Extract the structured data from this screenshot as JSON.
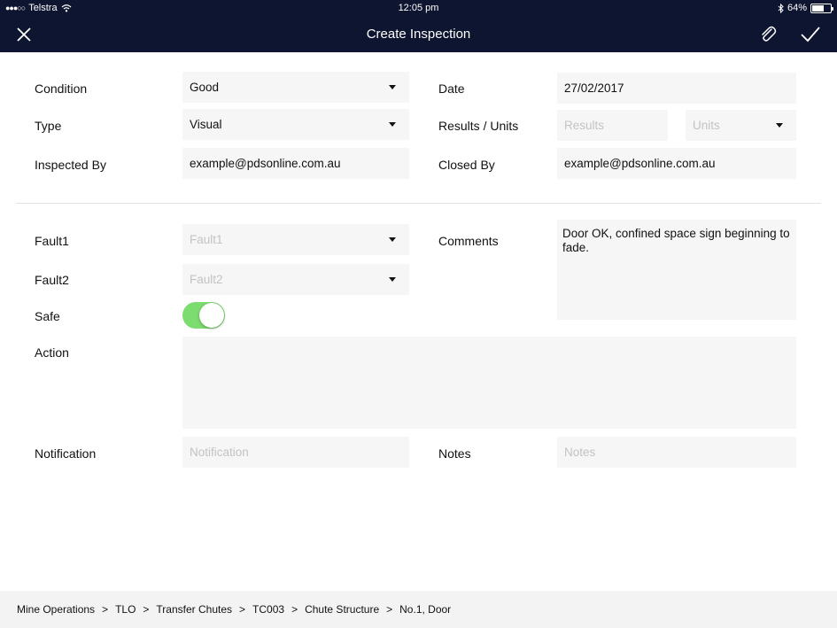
{
  "status_bar": {
    "carrier": "Telstra",
    "time": "12:05 pm",
    "battery": "64%",
    "battery_level": 0.64
  },
  "nav": {
    "title": "Create Inspection",
    "close_icon": "close-icon",
    "attach_icon": "paperclip-icon",
    "confirm_icon": "checkmark-icon"
  },
  "form": {
    "condition": {
      "label": "Condition",
      "value": "Good"
    },
    "type": {
      "label": "Type",
      "value": "Visual"
    },
    "inspected_by": {
      "label": "Inspected By",
      "value": "example@pdsonline.com.au"
    },
    "date": {
      "label": "Date",
      "value": "27/02/2017"
    },
    "results_units": {
      "label": "Results / Units",
      "results_placeholder": "Results",
      "units_placeholder": "Units"
    },
    "closed_by": {
      "label": "Closed By",
      "value": "example@pdsonline.com.au"
    },
    "fault1": {
      "label": "Fault1",
      "placeholder": "Fault1"
    },
    "fault2": {
      "label": "Fault2",
      "placeholder": "Fault2"
    },
    "safe": {
      "label": "Safe",
      "on": true
    },
    "comments": {
      "label": "Comments",
      "value": "Door OK, confined space sign beginning to fade."
    },
    "action": {
      "label": "Action",
      "value": ""
    },
    "notification": {
      "label": "Notification",
      "placeholder": "Notification"
    },
    "notes": {
      "label": "Notes",
      "placeholder": "Notes"
    }
  },
  "breadcrumb": [
    "Mine Operations",
    "TLO",
    "Transfer Chutes",
    "TC003",
    "Chute Structure",
    "No.1, Door"
  ],
  "breadcrumb_separator": ">",
  "colors": {
    "nav_background": "#0d1530",
    "field_background": "#f5f6f5",
    "toggle_on": "#7ddc6f",
    "footer_background": "#f2f3f2"
  }
}
